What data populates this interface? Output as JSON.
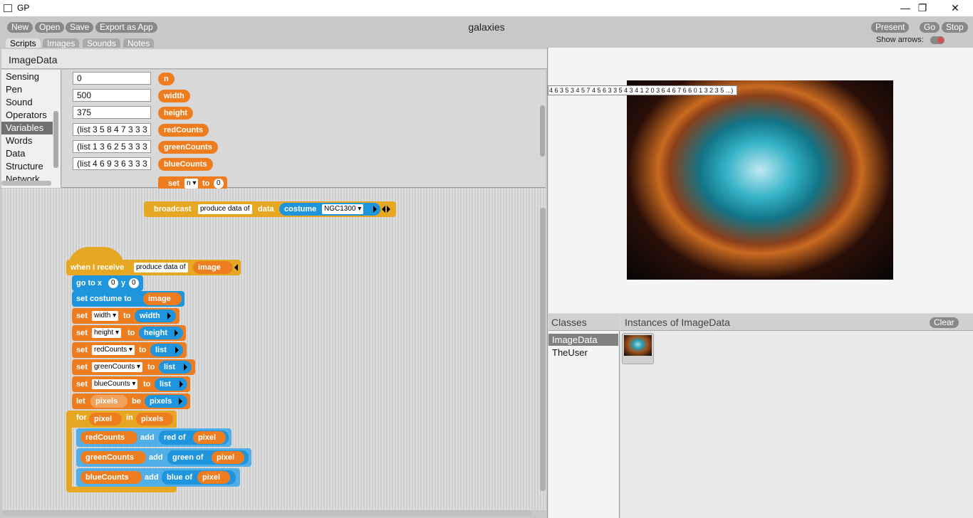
{
  "window": {
    "title": "GP",
    "minimize": "—",
    "maximize": "❐",
    "close": "✕"
  },
  "toolbar": {
    "new": "New",
    "open": "Open",
    "save": "Save",
    "export": "Export as App",
    "present": "Present",
    "go": "Go",
    "stop": "Stop"
  },
  "project_title": "galaxies",
  "show_arrows_label": "Show arrows:",
  "tabs": [
    "Scripts",
    "Images",
    "Sounds",
    "Notes"
  ],
  "class_name": "ImageData",
  "categories": [
    "Sensing",
    "Pen",
    "Sound",
    "Operators",
    "Variables",
    "Words",
    "Data",
    "Structure",
    "Network"
  ],
  "selected_category": "Variables",
  "variables": [
    {
      "value": "0",
      "name": "n"
    },
    {
      "value": "500",
      "name": "width"
    },
    {
      "value": "375",
      "name": "height"
    },
    {
      "value": "(list 3 5 8 4 7 3 3 3",
      "name": "redCounts"
    },
    {
      "value": "(list 1 3 6 2 5 3 3 3",
      "name": "greenCounts"
    },
    {
      "value": "(list 4 6 9 3 6 3 3 3",
      "name": "blueCounts"
    }
  ],
  "set_block": {
    "set": "set",
    "var": "n",
    "to": "to",
    "value": "0"
  },
  "broadcast_block": {
    "label": "broadcast",
    "msg": "produce data of",
    "data": "data",
    "costume": "costume",
    "costume_name": "NGC1300"
  },
  "script": {
    "hat": {
      "label": "when I receive",
      "msg": "produce data of",
      "param": "image"
    },
    "goto": {
      "label": "go to x",
      "x": "0",
      "ylabel": "y",
      "y": "0"
    },
    "setcostume": {
      "label": "set costume to",
      "arg": "image"
    },
    "sets": [
      {
        "set": "set",
        "var": "width",
        "to": "to",
        "val": "width"
      },
      {
        "set": "set",
        "var": "height",
        "to": "to",
        "val": "height"
      },
      {
        "set": "set",
        "var": "redCounts",
        "to": "to",
        "val": "list"
      },
      {
        "set": "set",
        "var": "greenCounts",
        "to": "to",
        "val": "list"
      },
      {
        "set": "set",
        "var": "blueCounts",
        "to": "to",
        "val": "list"
      }
    ],
    "let": {
      "label": "let",
      "var": "pixels",
      "be": "be",
      "val": "pixels"
    },
    "for": {
      "label": "for",
      "var": "pixel",
      "in": "in",
      "list": "pixels"
    },
    "adds": [
      {
        "list": "redCounts",
        "add": "add",
        "fn": "red of",
        "arg": "pixel"
      },
      {
        "list": "greenCounts",
        "add": "add",
        "fn": "green of",
        "arg": "pixel"
      },
      {
        "list": "blueCounts",
        "add": "add",
        "fn": "blue of",
        "arg": "pixel"
      }
    ]
  },
  "stage_watcher": "4 6 3 5 3 4 5 7 4 5 6 3 3 5 4 3 4 1 2 0 3 6 4 6 7 6 6 0 1 3 2 3 5 ...)",
  "classes_header": "Classes",
  "classes": [
    "ImageData",
    "TheUser"
  ],
  "instances_header": "Instances of ImageData",
  "clear_label": "Clear",
  "colors": {
    "variables": "#ee7d1f",
    "control": "#e6a823",
    "motion": "#1f95de"
  }
}
